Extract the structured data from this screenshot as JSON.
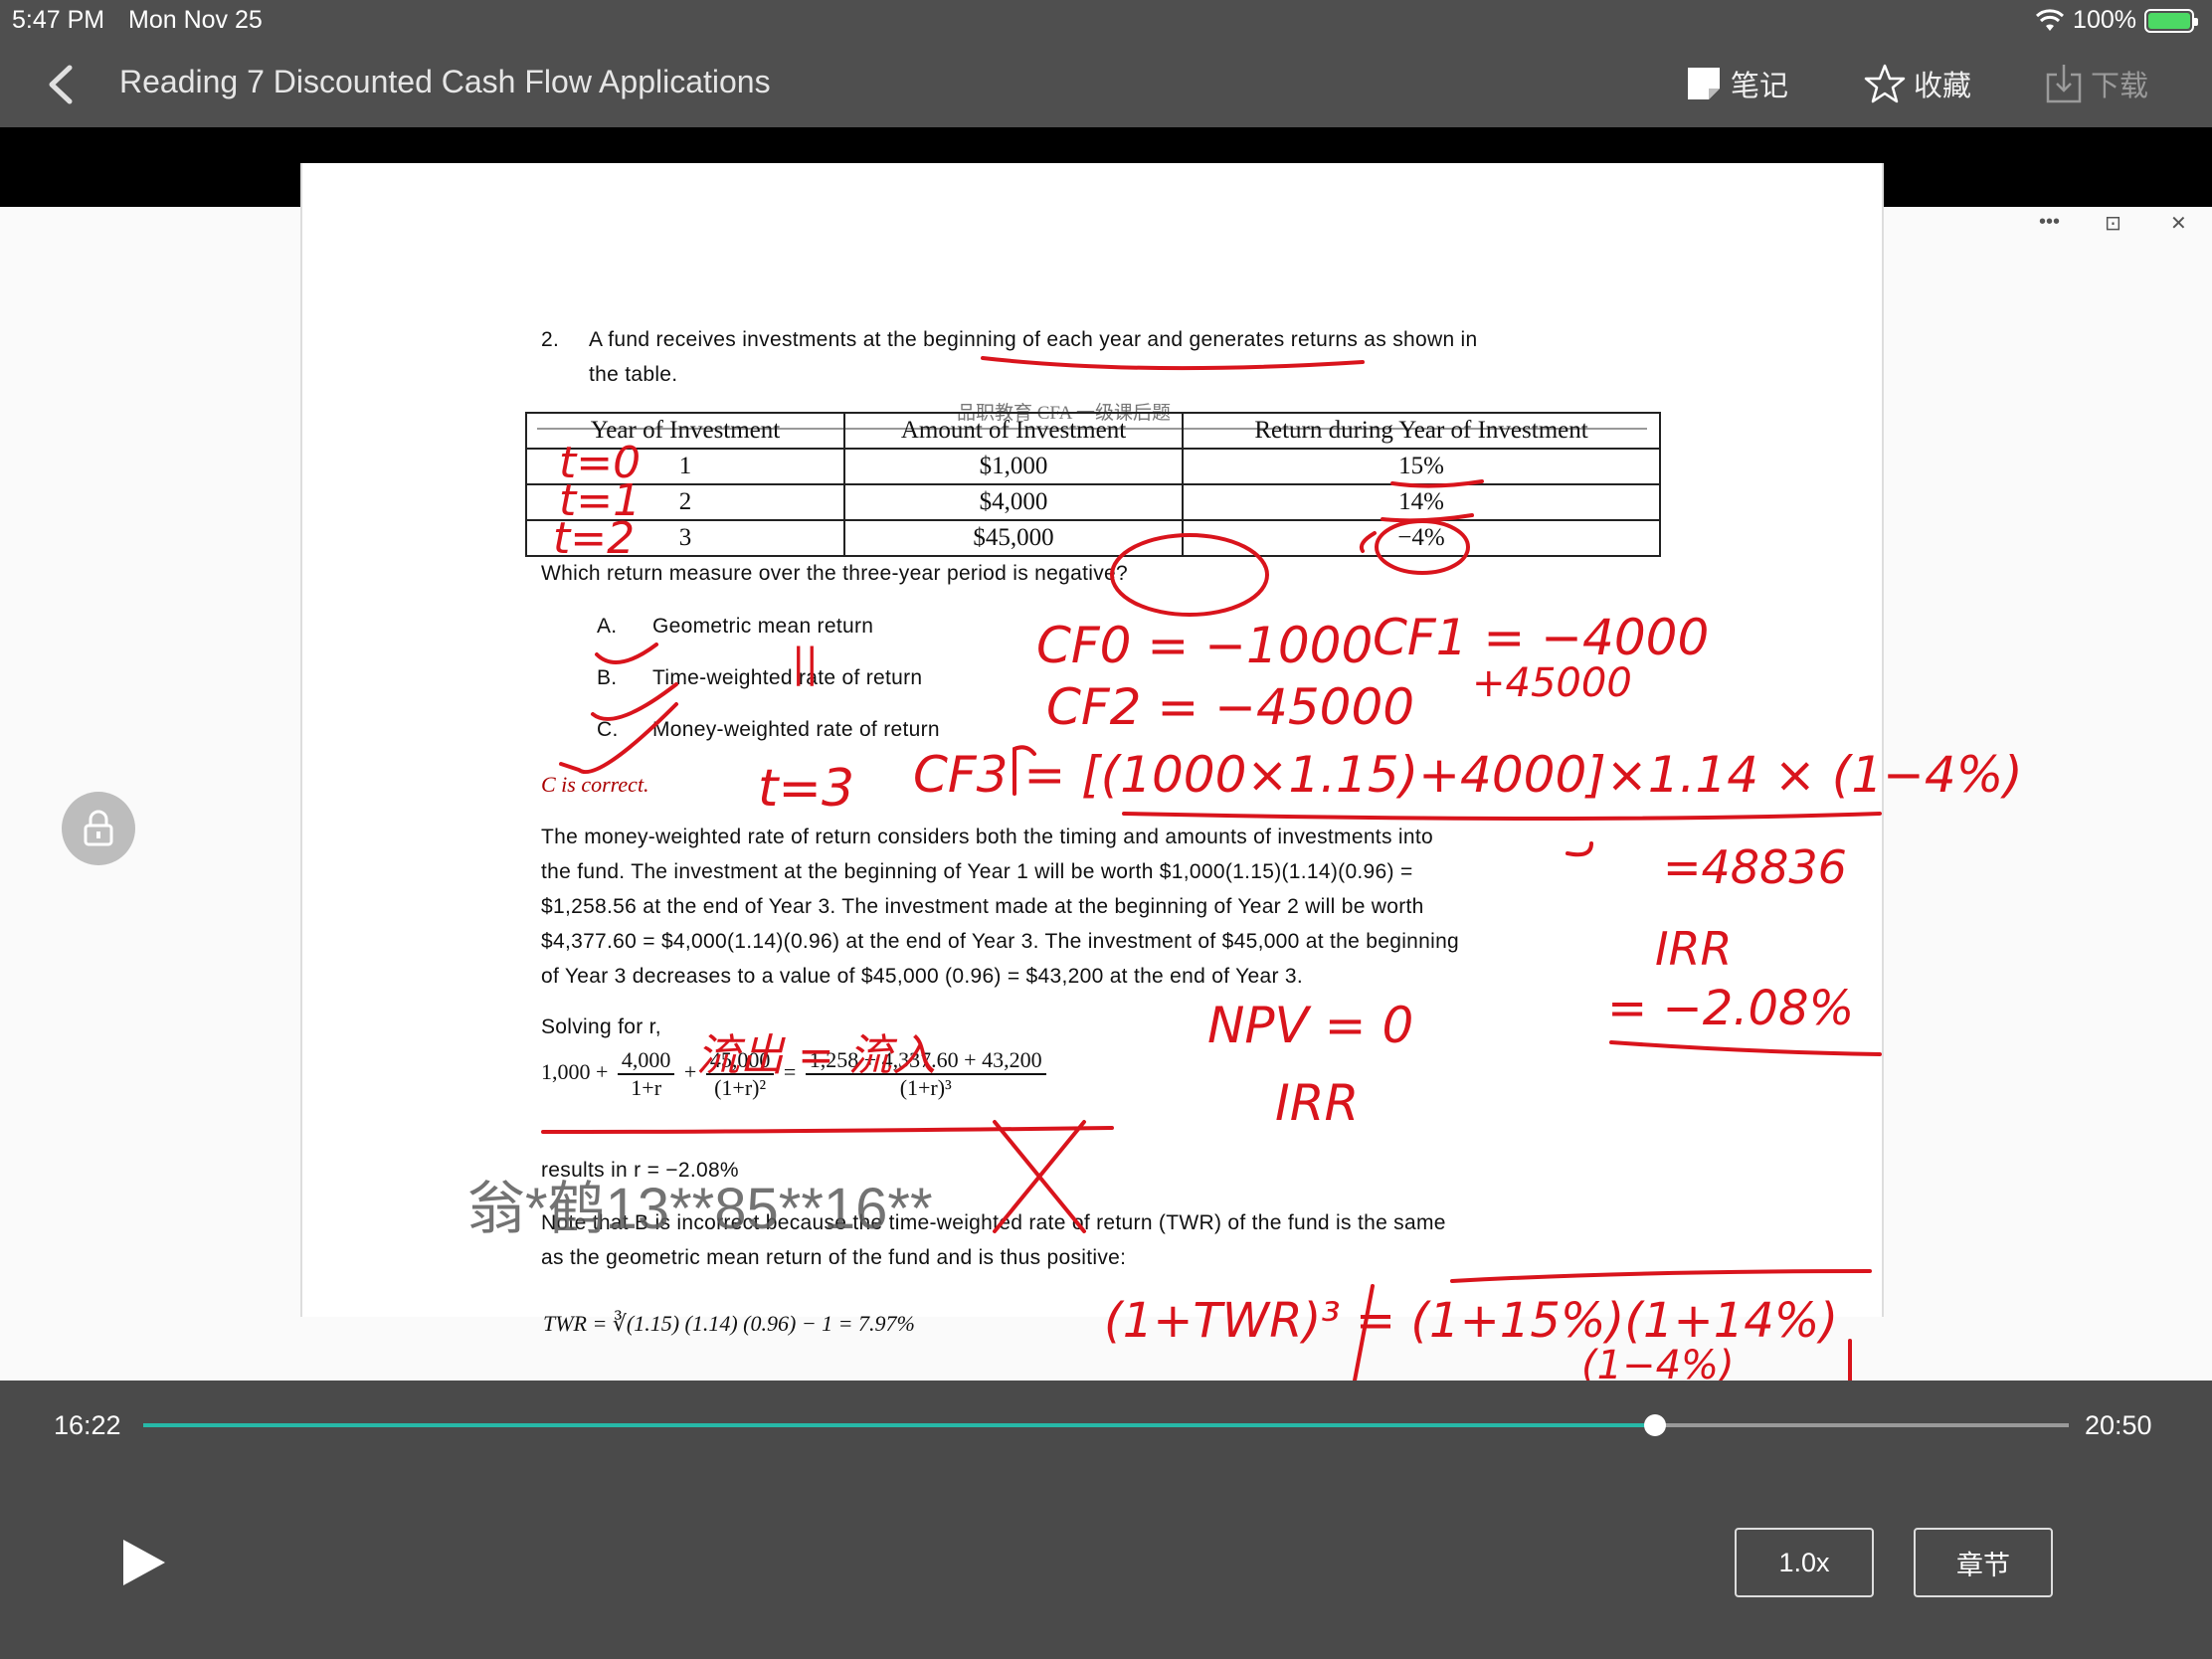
{
  "status_bar": {
    "time": "5:47 PM",
    "date": "Mon Nov 25",
    "battery": "100%"
  },
  "nav": {
    "title": "Reading 7 Discounted Cash Flow Applications",
    "actions": {
      "note": "笔记",
      "favorite": "收藏",
      "download": "下载"
    }
  },
  "document": {
    "header": "品职教育  CFA 一级课后题",
    "question_number": "2.",
    "question_line1": "A fund receives investments at the beginning of each year and generates returns as shown in",
    "question_line2": "the table.",
    "table": {
      "headers": [
        "Year of Investment",
        "Amount of Investment",
        "Return during Year of Investment"
      ],
      "rows": [
        [
          "1",
          "$1,000",
          "15%"
        ],
        [
          "2",
          "$4,000",
          "14%"
        ],
        [
          "3",
          "$45,000",
          "−4%"
        ]
      ]
    },
    "prompt": "Which return measure over the three-year period is negative?",
    "options": [
      {
        "letter": "A.",
        "text": "Geometric mean return"
      },
      {
        "letter": "B.",
        "text": "Time-weighted rate of return"
      },
      {
        "letter": "C.",
        "text": "Money-weighted rate of return"
      }
    ],
    "answer": "C is correct.",
    "explanation": [
      "The money-weighted rate of return considers both the timing and amounts of investments into",
      "the fund. The investment at the beginning of Year 1 will be worth $1,000(1.15)(1.14)(0.96) =",
      "$1,258.56 at the end of Year 3. The investment made at the beginning of Year 2 will be worth",
      "$4,377.60 = $4,000(1.14)(0.96) at the end of Year 3. The investment of $45,000 at the beginning",
      "of Year 3 decreases to a value of $45,000 (0.96) = $43,200 at the end of Year 3."
    ],
    "solving_label": "Solving for r,",
    "equation": {
      "term1": "1,000",
      "t2_num": "4,000",
      "t2_den": "1+r",
      "t3_num": "45,000",
      "t3_den": "(1+r)²",
      "rhs_num": "1,258 + 4,337.60 + 43,200",
      "rhs_den": "(1+r)³"
    },
    "result": "results in r = −2.08%",
    "note_line1": "Note that B is incorrect because the time-weighted rate of return (TWR) of the fund is the same",
    "note_line2": "as the geometric mean return of the fund and is thus positive:",
    "twr_formula": "TWR = ∛(1.15) (1.14) (0.96) − 1 = 7.97%"
  },
  "handwriting": {
    "t0": "t=0",
    "t1": "t=1",
    "t2": "t=2",
    "cf0": "CF0 = −1000",
    "cf1": "CF1 = −4000",
    "cf2": "CF2 = −45000",
    "plus": "+45000",
    "t3": "t=3",
    "cf3": "CF3 = [(1000×1.15)+4000]×1.14 × (1−4%)",
    "eq_val": "=48836",
    "irr1": "IRR",
    "irr_val": "= −2.08%",
    "npv": "NPV = 0",
    "irr2": "IRR",
    "outflow_inflow": "流出 = 流入",
    "twr": "(1+TWR)³ = (1+15%)(1+14%)",
    "twr2": "(1−4%)",
    "eleven": "||"
  },
  "watermark": "翁*鹤13**85**16**",
  "player": {
    "current_time": "16:22",
    "total_time": "20:50",
    "progress": 0.785,
    "speed": "1.0x",
    "chapter": "章节"
  },
  "colors": {
    "accent": "#27b9a8",
    "ink": "#d9141c"
  }
}
